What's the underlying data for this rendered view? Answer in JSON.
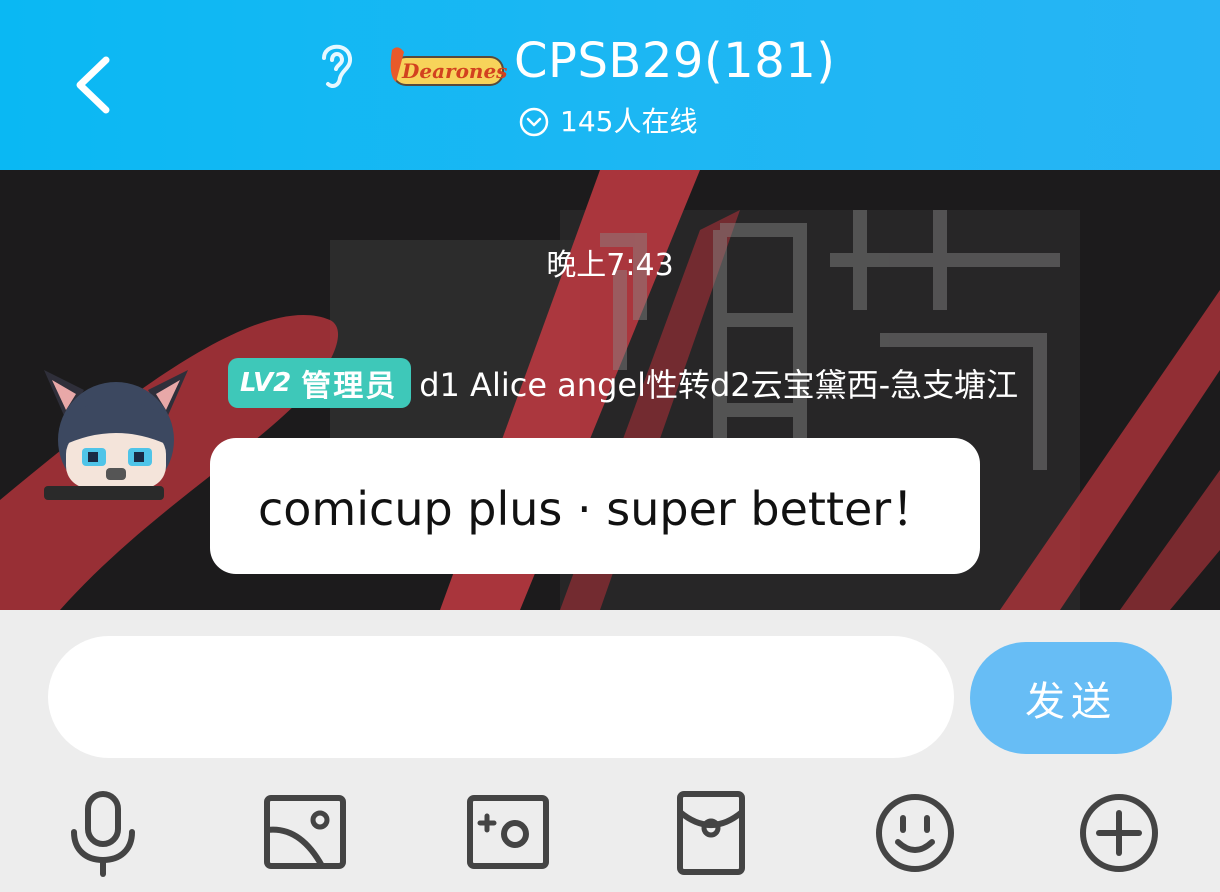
{
  "header": {
    "group_name": "CPSB29(181)",
    "online_count": "145人在线",
    "logo_text": "Dearones"
  },
  "chat": {
    "timestamp": "晚上7:43",
    "message": {
      "level_badge": "LV2",
      "role_badge": "管理员",
      "sender": "d1 Alice angel性转d2云宝黛西-急支塘江",
      "text": "comicup plus · super better！"
    }
  },
  "composer": {
    "input_value": "",
    "send_label": "发送",
    "tools": [
      "microphone-icon",
      "image-icon",
      "camera-icon",
      "red-packet-icon",
      "emoji-icon",
      "plus-icon"
    ]
  },
  "colors": {
    "header": "#1db7f3",
    "badge": "#3ec8b9",
    "send": "#67bdf5"
  }
}
